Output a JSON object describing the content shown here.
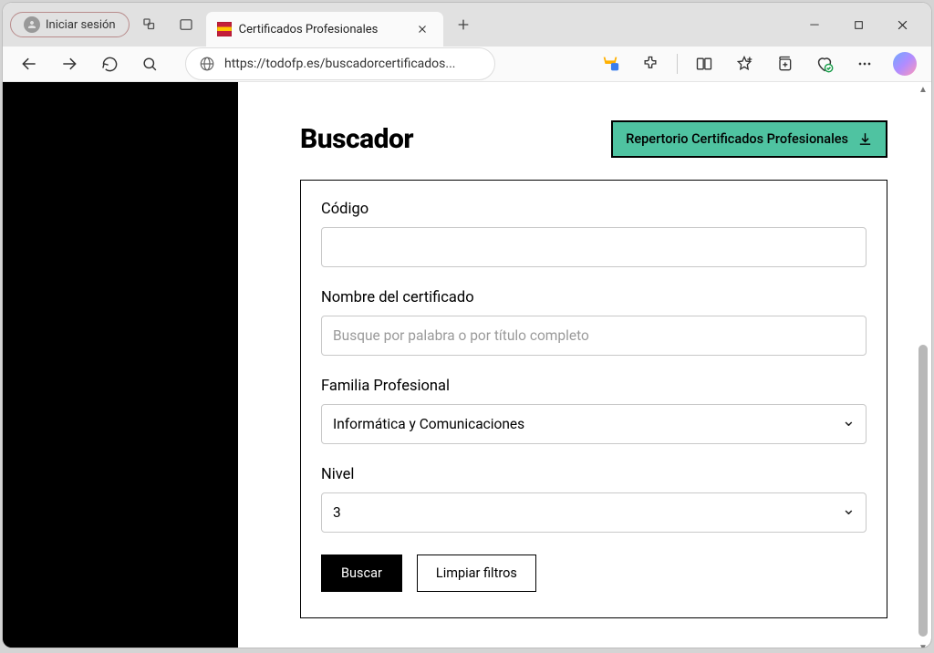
{
  "browser": {
    "sign_in_label": "Iniciar sesión",
    "tab_title": "Certificados Profesionales",
    "url_display": "https://todofp.es/buscadorcertificados..."
  },
  "page": {
    "title": "Buscador",
    "repertorio_label": "Repertorio Certificados Profesionales"
  },
  "form": {
    "codigo_label": "Código",
    "codigo_value": "",
    "nombre_label": "Nombre del certificado",
    "nombre_placeholder": "Busque por palabra o por título completo",
    "nombre_value": "",
    "familia_label": "Familia Profesional",
    "familia_value": "Informática y Comunicaciones",
    "nivel_label": "Nivel",
    "nivel_value": "3",
    "buscar_label": "Buscar",
    "limpiar_label": "Limpiar filtros"
  }
}
